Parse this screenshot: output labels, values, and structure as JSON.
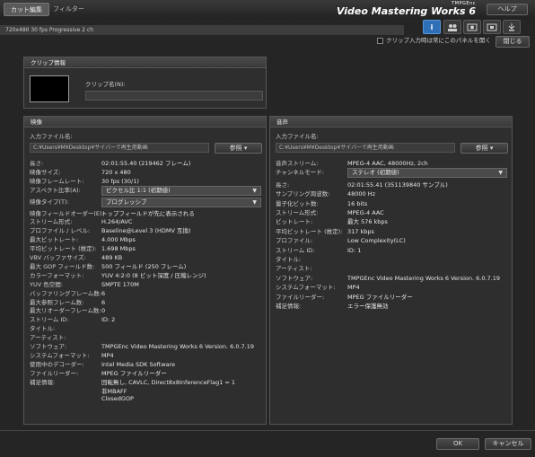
{
  "tabs": {
    "cut_edit": "カット編集",
    "filter": "フィルター"
  },
  "brand": {
    "small": "TMPGEnc",
    "large": "Video Mastering Works 6"
  },
  "help_label": "ヘルプ",
  "info_bar": "720x480 30 fps Progressive  2 ch",
  "top_options": {
    "checkbox_label": "クリップ入力時は常にこのパネルを開く",
    "close_label": "閉じる"
  },
  "clip_info": {
    "header": "クリップ情報",
    "name_label": "クリップ名(N):",
    "name_value": ""
  },
  "video": {
    "header": "映像",
    "input_label": "入力ファイル名:",
    "input_path": "C:¥Users¥M¥Desktop¥サイバーで再生用動画",
    "browse_label": "参照",
    "rows": [
      {
        "label": "長さ:",
        "value": "02:01:55.40 (219462 フレーム)"
      },
      {
        "label": "映像サイズ:",
        "value": "720 x 480"
      },
      {
        "label": "映像フレームレート:",
        "value": "30 fps (30/1)"
      },
      {
        "label": "アスペクト比率(A):",
        "value": "ピクセル比 1:1 (初期値)",
        "dropdown": true
      },
      {
        "label": "映像タイプ(T):",
        "value": "プログレッシブ",
        "dropdown": true
      },
      {
        "label": "映像フィールドオーダー(E):",
        "value": "トップフィールドが先に表示される"
      },
      {
        "label": "ストリーム形式:",
        "value": "H.264/AVC"
      },
      {
        "label": "プロファイル / レベル:",
        "value": "Baseline@Level 3 (HDMV 互換)"
      },
      {
        "label": "最大ビットレート:",
        "value": "4.000 Mbps"
      },
      {
        "label": "平均ビットレート (推定):",
        "value": "1.698 Mbps"
      },
      {
        "label": "VBV バッファサイズ:",
        "value": "489 KB"
      },
      {
        "label": "最大 GOP フィールド数:",
        "value": "500 フィールド (250 フレーム)"
      },
      {
        "label": "カラーフォーマット:",
        "value": "YUV 4:2:0 (8 ビット深度 / 圧縮レンジ)"
      },
      {
        "label": "YUV 色空間:",
        "value": "SMPTE 170M"
      },
      {
        "label": "バッファリングフレーム数:",
        "value": "6"
      },
      {
        "label": "最大参照フレーム数:",
        "value": "6"
      },
      {
        "label": "最大リオーダーフレーム数:",
        "value": "0"
      },
      {
        "label": "ストリーム ID:",
        "value": "ID: 2"
      },
      {
        "label": "タイトル:",
        "value": ""
      },
      {
        "label": "アーティスト:",
        "value": ""
      },
      {
        "label": "ソフトウェア:",
        "value": "TMPGEnc Video Mastering Works 6 Version. 6.0.7.19"
      },
      {
        "label": "システムフォーマット:",
        "value": "MP4"
      },
      {
        "label": "使用中のデコーダー:",
        "value": "Intel Media SDK Software"
      },
      {
        "label": "ファイルリーダー:",
        "value": "MPEG ファイルリーダー"
      },
      {
        "label": "補足情報:",
        "value": "回転無し, CAVLC, Direct8x8InferenceFlag1 = 1"
      }
    ],
    "extra_lines": [
      "非MBAFF",
      "ClosedGOP"
    ]
  },
  "audio": {
    "header": "音声",
    "input_label": "入力ファイル名:",
    "input_path": "C:¥Users¥M¥Desktop¥サイバーで再生用動画",
    "browse_label": "参照",
    "rows": [
      {
        "label": "音声ストリーム:",
        "value": "MPEG-4 AAC, 48000Hz, 2ch"
      },
      {
        "label": "チャンネルモード:",
        "value": "ステレオ (初期値)",
        "dropdown": true
      },
      {
        "label": "長さ:",
        "value": "02:01:55.41 (351139840 サンプル)"
      },
      {
        "label": "サンプリング周波数:",
        "value": "48000 Hz"
      },
      {
        "label": "量子化ビット数:",
        "value": "16 bits"
      },
      {
        "label": "ストリーム形式:",
        "value": "MPEG-4 AAC"
      },
      {
        "label": "ビットレート:",
        "value": "最大 576 kbps"
      },
      {
        "label": "平均ビットレート (推定):",
        "value": "317 kbps"
      },
      {
        "label": "プロファイル:",
        "value": "Low Complexity(LC)"
      },
      {
        "label": "ストリーム ID:",
        "value": "ID: 1"
      },
      {
        "label": "タイトル:",
        "value": ""
      },
      {
        "label": "アーティスト:",
        "value": ""
      },
      {
        "label": "ソフトウェア:",
        "value": "TMPGEnc Video Mastering Works 6 Version. 6.0.7.19"
      },
      {
        "label": "システムフォーマット:",
        "value": "MP4"
      },
      {
        "label": "ファイルリーダー:",
        "value": "MPEG ファイルリーダー"
      },
      {
        "label": "補足情報:",
        "value": "エラー保護無効"
      }
    ]
  },
  "footer": {
    "ok": "OK",
    "cancel": "キャンセル"
  },
  "icons": [
    "info-icon",
    "group-icon",
    "video-settings-icon",
    "audio-settings-icon",
    "export-icon"
  ]
}
